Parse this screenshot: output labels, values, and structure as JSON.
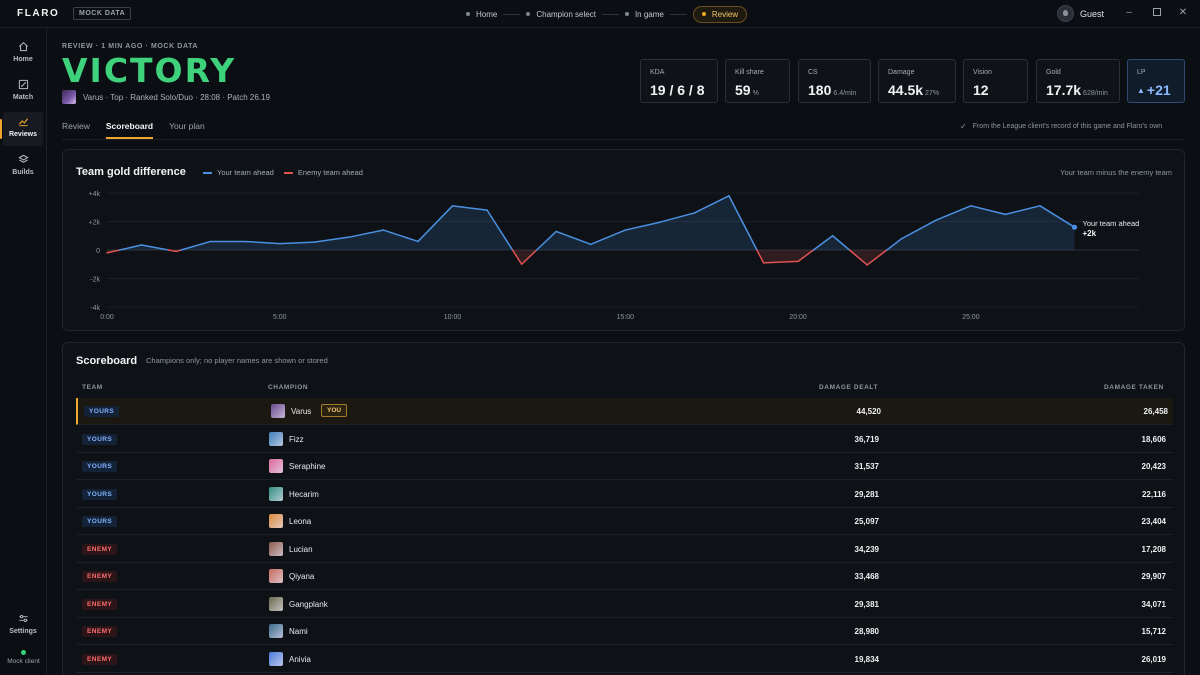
{
  "app": {
    "brand": "FLARO",
    "mock_badge": "MOCK DATA"
  },
  "steps": [
    {
      "label": "Home"
    },
    {
      "label": "Champion select"
    },
    {
      "label": "In game"
    },
    {
      "label": "Review",
      "active": true
    }
  ],
  "user": {
    "name": "Guest"
  },
  "sidebar": {
    "items": [
      {
        "label": "Home",
        "icon": "home-icon"
      },
      {
        "label": "Match",
        "icon": "match-icon"
      },
      {
        "label": "Reviews",
        "icon": "chart-line-icon",
        "active": true
      },
      {
        "label": "Builds",
        "icon": "layers-icon"
      }
    ],
    "settings_label": "Settings",
    "client_status": "Mock client"
  },
  "header": {
    "crumb": "REVIEW · 1 MIN AGO · MOCK DATA",
    "result": "VICTORY",
    "meta": "Varus · Top · Ranked Solo/Duo · 28:08 · Patch 26.19"
  },
  "stats": {
    "kda": {
      "label": "KDA",
      "value": "19 / 6 / 8"
    },
    "kill_share": {
      "label": "Kill share",
      "value": "59",
      "sub": "%"
    },
    "cs": {
      "label": "CS",
      "value": "180",
      "sub": "6.4/min"
    },
    "damage": {
      "label": "Damage",
      "value": "44.5k",
      "sub": "27%"
    },
    "vision": {
      "label": "Vision",
      "value": "12"
    },
    "gold": {
      "label": "Gold",
      "value": "17.7k",
      "sub": "628/min"
    },
    "lp": {
      "label": "LP",
      "value": "+21"
    }
  },
  "tabs": [
    {
      "label": "Review"
    },
    {
      "label": "Scoreboard",
      "active": true
    },
    {
      "label": "Your plan"
    }
  ],
  "source_note": "From the League client's record of this game and Flaro's own",
  "gold_panel": {
    "title": "Team gold difference",
    "legend_ahead": "Your team ahead",
    "legend_behind": "Enemy team ahead",
    "note": "Your team minus the enemy team",
    "end_label": "Your team ahead",
    "end_value": "+2k"
  },
  "chart_data": {
    "type": "area",
    "title": "Team gold difference",
    "xlabel": "",
    "ylabel": "",
    "x_ticks": [
      "0:00",
      "5:00",
      "10:00",
      "15:00",
      "20:00",
      "25:00"
    ],
    "x_tick_minutes": [
      0,
      5,
      10,
      15,
      20,
      25
    ],
    "y_ticks": [
      "+4k",
      "+2k",
      "0",
      "-2k",
      "-4k"
    ],
    "y_tick_values": [
      4000,
      2000,
      0,
      -2000,
      -4000
    ],
    "ylim": [
      -4000,
      4000
    ],
    "xlim": [
      0,
      28.13
    ],
    "grid": true,
    "series": [
      {
        "name": "Your team ahead",
        "color_positive": "#4a90e2",
        "color_negative": "#e05252",
        "minutes": [
          0,
          1,
          2,
          3,
          4,
          5,
          6,
          7,
          8,
          9,
          10,
          11,
          12,
          13,
          14,
          15,
          16,
          17,
          18,
          19,
          20,
          21,
          22,
          23,
          24,
          25,
          26,
          27,
          28
        ],
        "values": [
          -200,
          350,
          -100,
          600,
          600,
          450,
          550,
          900,
          1400,
          600,
          3100,
          2800,
          -1000,
          1300,
          400,
          1400,
          1950,
          2600,
          3800,
          -900,
          -800,
          1000,
          -1050,
          800,
          2100,
          3100,
          2500,
          3100,
          1600
        ]
      }
    ]
  },
  "scoreboard": {
    "title": "Scoreboard",
    "subtitle": "Champions only; no player names are shown or stored",
    "headers": {
      "team": "TEAM",
      "champion": "CHAMPION",
      "damage_dealt": "DAMAGE DEALT",
      "damage_taken": "DAMAGE TAKEN"
    },
    "you_label": "YOU",
    "rows": [
      {
        "team": "YOURS",
        "side": "yours",
        "champion": "Varus",
        "you": true,
        "dealt": "44,520",
        "taken": "26,458",
        "color": "#6a4a8c"
      },
      {
        "team": "YOURS",
        "side": "yours",
        "champion": "Fizz",
        "dealt": "36,719",
        "taken": "18,606",
        "color": "#3c7fb8"
      },
      {
        "team": "YOURS",
        "side": "yours",
        "champion": "Seraphine",
        "dealt": "31,537",
        "taken": "20,423",
        "color": "#d96a9a"
      },
      {
        "team": "YOURS",
        "side": "yours",
        "champion": "Hecarim",
        "dealt": "29,281",
        "taken": "22,116",
        "color": "#2f8f7f"
      },
      {
        "team": "YOURS",
        "side": "yours",
        "champion": "Leona",
        "dealt": "25,097",
        "taken": "23,404",
        "color": "#d98a3a"
      },
      {
        "team": "ENEMY",
        "side": "enemy",
        "champion": "Lucian",
        "dealt": "34,239",
        "taken": "17,208",
        "color": "#8a5a4a"
      },
      {
        "team": "ENEMY",
        "side": "enemy",
        "champion": "Qiyana",
        "dealt": "33,468",
        "taken": "29,907",
        "color": "#c46a5a"
      },
      {
        "team": "ENEMY",
        "side": "enemy",
        "champion": "Gangplank",
        "dealt": "29,381",
        "taken": "34,071",
        "color": "#6a6a4a"
      },
      {
        "team": "ENEMY",
        "side": "enemy",
        "champion": "Nami",
        "dealt": "28,980",
        "taken": "15,712",
        "color": "#3a6a8a"
      },
      {
        "team": "ENEMY",
        "side": "enemy",
        "champion": "Anivia",
        "dealt": "19,834",
        "taken": "26,019",
        "color": "#4a7ad9"
      }
    ]
  }
}
